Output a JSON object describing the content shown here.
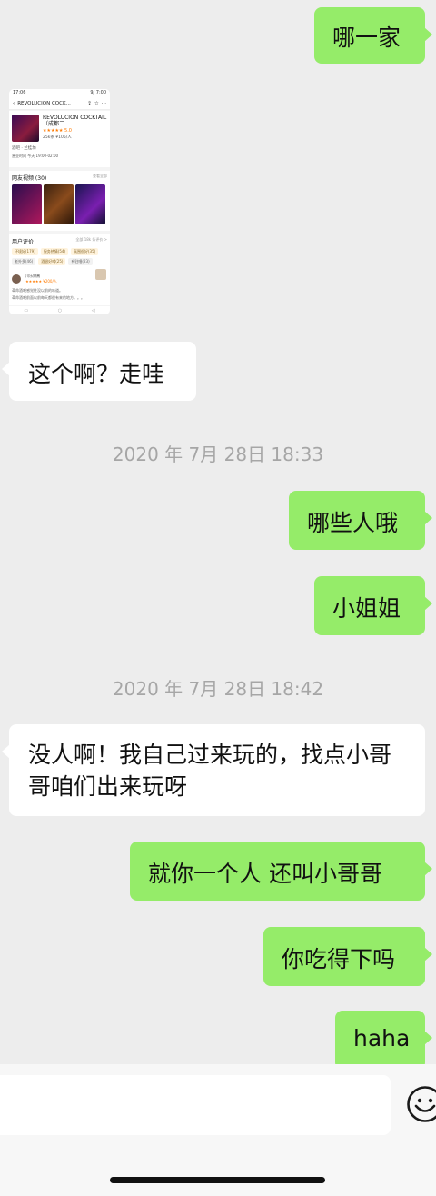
{
  "messages": [
    {
      "side": "out",
      "text": "哪一家"
    },
    {
      "side": "in",
      "text": "这个啊？走哇"
    },
    {
      "side": "out",
      "text": "哪些人哦"
    },
    {
      "side": "out",
      "text": "小姐姐"
    },
    {
      "side": "in",
      "text": "没人啊！我自己过来玩的，找点小哥哥咱们出来玩呀"
    },
    {
      "side": "out",
      "text": "就你一个人 还叫小哥哥"
    },
    {
      "side": "out",
      "text": "你吃得下吗"
    },
    {
      "side": "out",
      "text": "haha"
    }
  ],
  "timestamps": [
    "2020 年 7月 28日 18:33",
    "2020 年 7月 28日 18:42"
  ],
  "shared_screenshot": {
    "status_time": "17:06",
    "status_right": "9/ 7:00",
    "nav_title": "REVOLUCION COCK...",
    "venue_name": "REVOLUCION COCKTAIL（成都二...",
    "rating_stars": "★★★★★",
    "rating_value": "5.0",
    "price": "25k条 ¥105/人",
    "tags": "酒吧 · 兰桂坊",
    "hours": "营业时间 今天 19:00-02:00",
    "video_section_title": "网友视频 (30)",
    "video_more": "查看全部",
    "review_section_title": "用户评价",
    "review_more": "全部 18k 条评价 >",
    "chips": [
      "环境好(179)",
      "服务热情(54)",
      "氛围很好(35)",
      "老外多(46)",
      "酒很好喝(25)",
      "有驻唱(23)"
    ],
    "reviewer": "川乐辣酱",
    "reviewer_price": "★★★★★ ¥200/人",
    "review_line1": "革命酒吧感觉性没以前的味道。",
    "review_line2": "革命酒吧前面以前每天都很有来的地方。。。"
  },
  "colors": {
    "background": "#ededed",
    "out_bubble": "#95ec69",
    "in_bubble": "#ffffff",
    "timestamp": "#a6a6a6"
  },
  "icons": {
    "emoji_button": "smiley-icon"
  }
}
